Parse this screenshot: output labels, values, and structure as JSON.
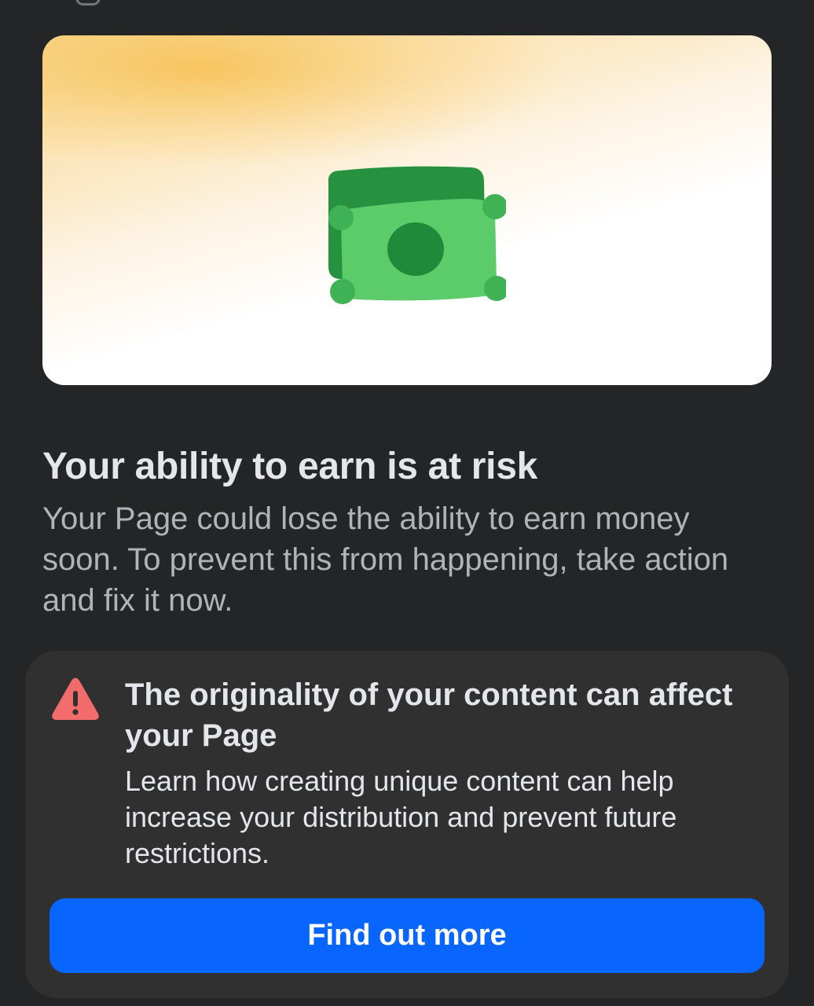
{
  "hero": {
    "icon": "money-bills-icon",
    "gradient_color": "#f6cd7a"
  },
  "headline": "Your ability to earn is at risk",
  "subtext": "Your Page could lose the ability to earn money soon. To prevent this from happening, take action and fix it now.",
  "card": {
    "icon": "warning-triangle-icon",
    "icon_color": "#f26c6c",
    "title": "The originality of your content can affect your Page",
    "text": "Learn how creating unique content can help increase your distribution and prevent future restrictions.",
    "button_label": "Find out more"
  },
  "colors": {
    "background": "#242526",
    "card": "#303031",
    "accent": "#0866ff"
  }
}
